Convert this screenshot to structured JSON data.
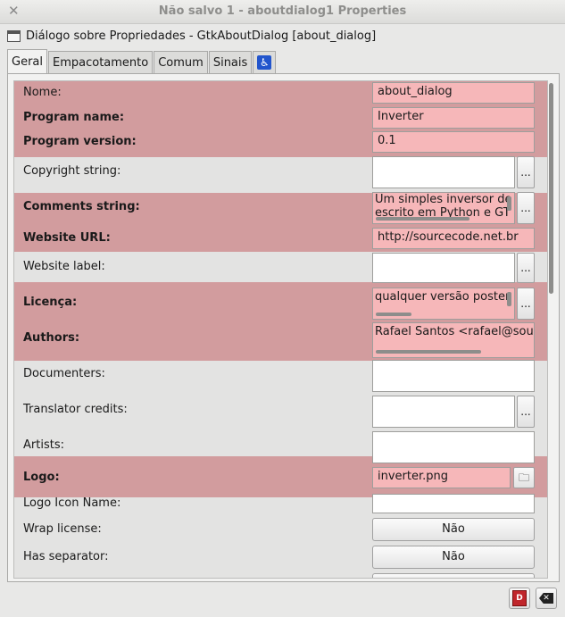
{
  "window": {
    "title": "Não salvo 1 - aboutdialog1 Properties",
    "close_icon": "close-icon"
  },
  "header": {
    "text": "Diálogo sobre Propriedades - GtkAboutDialog [about_dialog]"
  },
  "tabs": [
    {
      "label": "Geral"
    },
    {
      "label": "Empacotamento"
    },
    {
      "label": "Comum"
    },
    {
      "label": "Sinais"
    },
    {
      "icon": "accessibility-icon"
    }
  ],
  "properties": {
    "nome": {
      "label": "Nome:",
      "value": "about_dialog"
    },
    "program_name": {
      "label": "Program name:",
      "value": "Inverter"
    },
    "program_version": {
      "label": "Program version:",
      "value": "0.1"
    },
    "copyright": {
      "label": "Copyright string:",
      "value": ""
    },
    "comments": {
      "label": "Comments string:",
      "value": "Um simples inversor de",
      "value2": "escrito em Python e GT"
    },
    "website_url": {
      "label": "Website URL:",
      "value": "http://sourcecode.net.br"
    },
    "website_label": {
      "label": "Website label:",
      "value": ""
    },
    "licenca": {
      "label": "Licença:",
      "value": "qualquer versão poster"
    },
    "authors": {
      "label": "Authors:",
      "value": "Rafael Santos <rafael@sourc"
    },
    "documenters": {
      "label": "Documenters:",
      "value": ""
    },
    "translator": {
      "label": "Translator credits:",
      "value": ""
    },
    "artists": {
      "label": "Artists:",
      "value": ""
    },
    "logo": {
      "label": "Logo:",
      "value": "inverter.png"
    },
    "logo_icon_name": {
      "label": "Logo Icon Name:",
      "value": ""
    },
    "wrap_license": {
      "label": "Wrap license:",
      "value": "Não"
    },
    "has_separator": {
      "label": "Has separator:",
      "value": "Não"
    }
  },
  "ellipsis": "...",
  "colors": {
    "highlight": "#c46266",
    "field_highlight": "#f6b7b9"
  }
}
